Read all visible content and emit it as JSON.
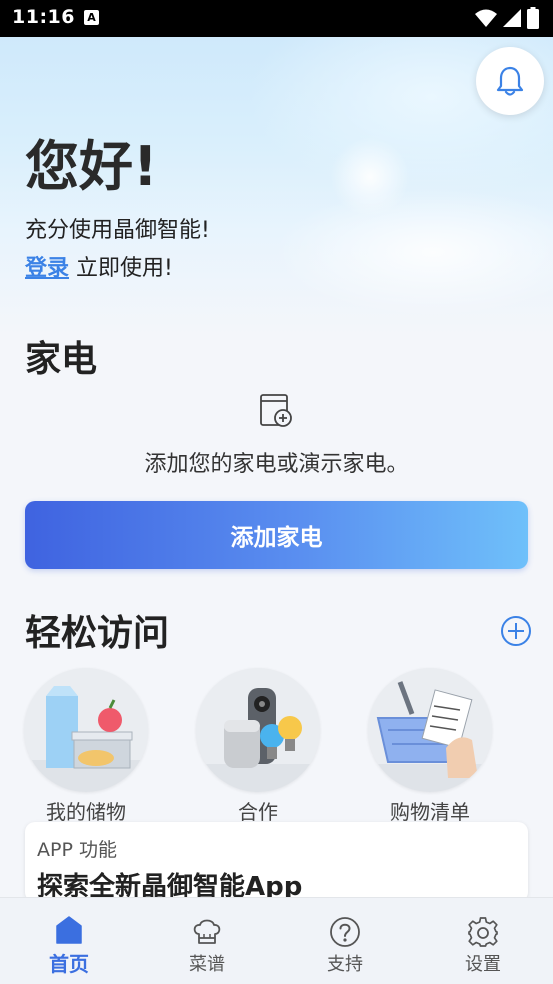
{
  "status_bar": {
    "time": "11:16",
    "notification_letter": "A"
  },
  "hero": {
    "greeting": "您好!",
    "subtitle": "充分使用晶御智能!",
    "login_link": "登录",
    "login_suffix": " 立即使用!"
  },
  "appliances": {
    "title": "家电",
    "empty_text": "添加您的家电或演示家电。",
    "add_button": "添加家电"
  },
  "quick_access": {
    "title": "轻松访问",
    "items": [
      {
        "label": "我的储物",
        "icon": "food-storage-icon"
      },
      {
        "label": "合作",
        "icon": "smart-devices-icon"
      },
      {
        "label": "购物清单",
        "icon": "shopping-basket-icon"
      }
    ]
  },
  "feature_card": {
    "tag": "APP 功能",
    "title": "探索全新晶御智能App"
  },
  "bottom_nav": {
    "items": [
      {
        "label": "首页",
        "icon": "home-icon",
        "active": true
      },
      {
        "label": "菜谱",
        "icon": "chef-hat-icon",
        "active": false
      },
      {
        "label": "支持",
        "icon": "help-icon",
        "active": false
      },
      {
        "label": "设置",
        "icon": "gear-icon",
        "active": false
      }
    ]
  },
  "colors": {
    "accent": "#3b6fe0",
    "link": "#3b82e6",
    "button_start": "#3f63e0",
    "button_end": "#6fc0fa"
  }
}
